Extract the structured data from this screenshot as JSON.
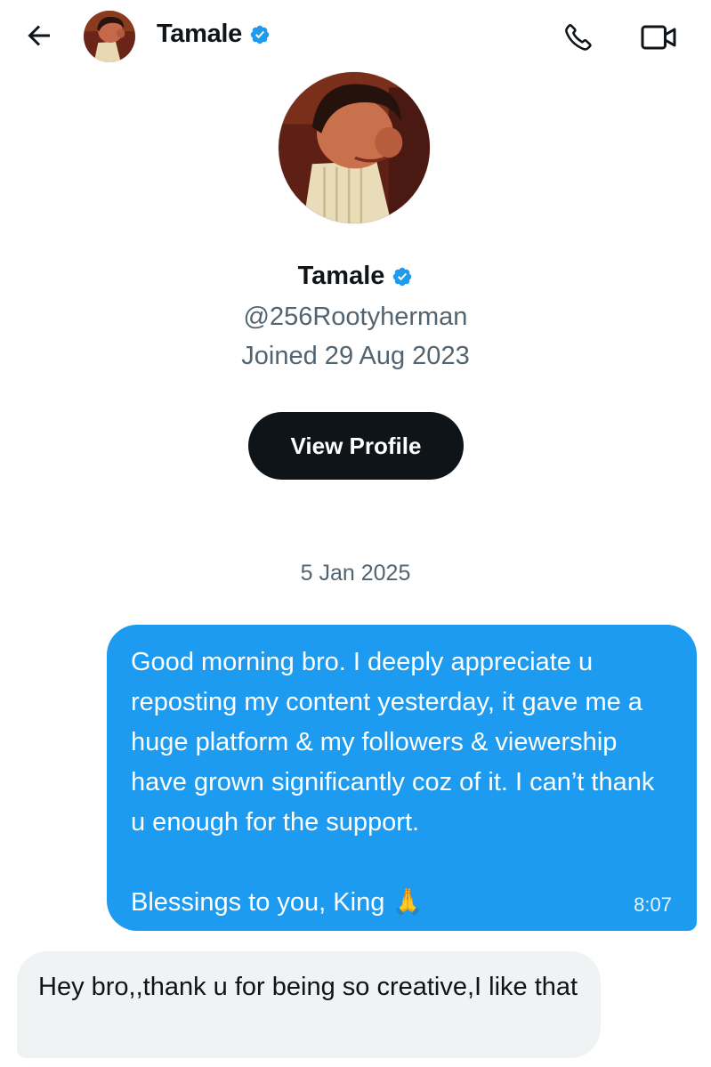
{
  "header": {
    "name": "Tamale",
    "verified": true,
    "icons": {
      "back": "arrow-left-icon",
      "call": "phone-icon",
      "video": "video-camera-icon"
    }
  },
  "profile": {
    "name": "Tamale",
    "handle": "@256Rootyherman",
    "joined": "Joined 29 Aug 2023",
    "button_label": "View Profile"
  },
  "conversation": {
    "date_separator": "5 Jan 2025",
    "messages": [
      {
        "direction": "outgoing",
        "text": "Good morning bro. I deeply appreciate u reposting my content yesterday, it gave me a huge platform & my followers & viewership have grown significantly coz of it. I can’t thank u enough for the support.\n\nBlessings to you, King 🙏",
        "time": "8:07"
      },
      {
        "direction": "incoming",
        "text": "Hey bro,,thank u for being so creative,I like that"
      }
    ]
  },
  "colors": {
    "accent": "#1d9bf0",
    "text_primary": "#0f1419",
    "text_secondary": "#536471",
    "incoming_bubble": "#eff3f4",
    "button_dark": "#0f1419"
  }
}
